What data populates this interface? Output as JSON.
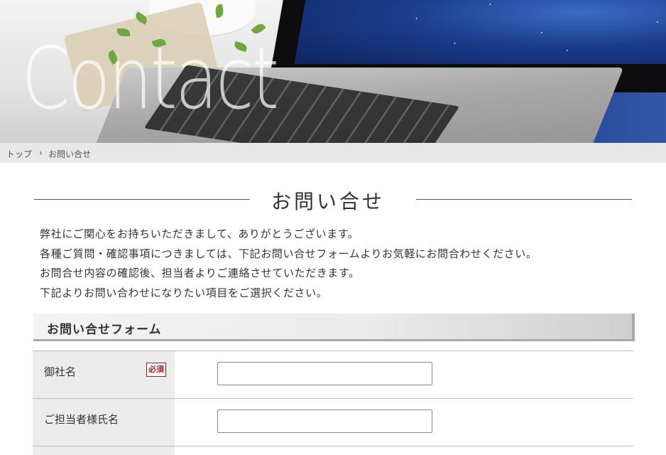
{
  "hero": {
    "title": "Contact"
  },
  "breadcrumb": {
    "home": "トップ",
    "separator": "›",
    "current": "お問い合せ"
  },
  "heading": {
    "title": "お問い合せ"
  },
  "intro": {
    "lines": [
      "弊社にご関心をお持ちいただきまして、ありがとうございます。",
      "各種ご質問・確認事項につきましては、下記お問い合せフォームよりお気軽にお問合わせください。",
      "お問合せ内容の確認後、担当者よりご連絡させていただきます。",
      "下記よりお問い合わせになりたい項目をご選択ください。"
    ]
  },
  "form": {
    "title": "お問い合せフォーム",
    "fields": [
      {
        "label": "御社名",
        "required_badge": "必須",
        "value": ""
      },
      {
        "label": "ご担当者様氏名",
        "value": ""
      }
    ]
  },
  "colors": {
    "required": "#9b1c1c",
    "label_bg": "#ececec",
    "breadcrumb_bg": "#e8e8e8"
  }
}
